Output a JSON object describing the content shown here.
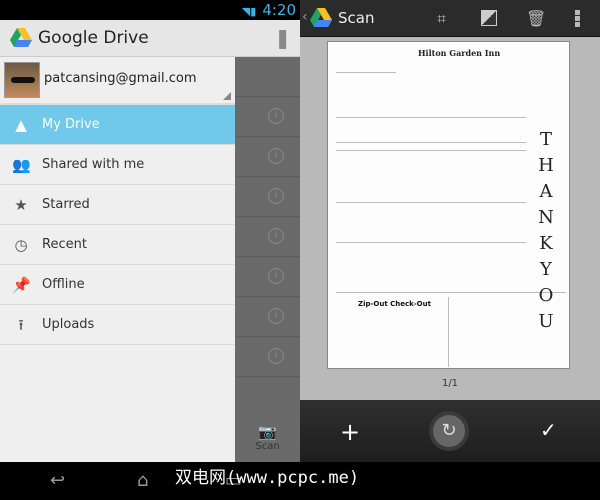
{
  "status": {
    "time": "4:20"
  },
  "drive": {
    "title": "Google Drive",
    "account": "patcansing@gmail.com",
    "items": [
      {
        "label": "My Drive"
      },
      {
        "label": "Shared with me"
      },
      {
        "label": "Starred"
      },
      {
        "label": "Recent"
      },
      {
        "label": "Offline"
      },
      {
        "label": "Uploads"
      }
    ],
    "scan_label": "Scan"
  },
  "scan": {
    "title": "Scan",
    "page_indicator": "1/1",
    "document": {
      "hotel": "Hilton Garden Inn",
      "thanks": "THANK YOU",
      "zip": "Zip-Out Check-Out"
    }
  },
  "watermark": "双电网(www.pcpc.me)",
  "colors": {
    "accent": "#70c8ea",
    "status": "#33b5e5"
  }
}
